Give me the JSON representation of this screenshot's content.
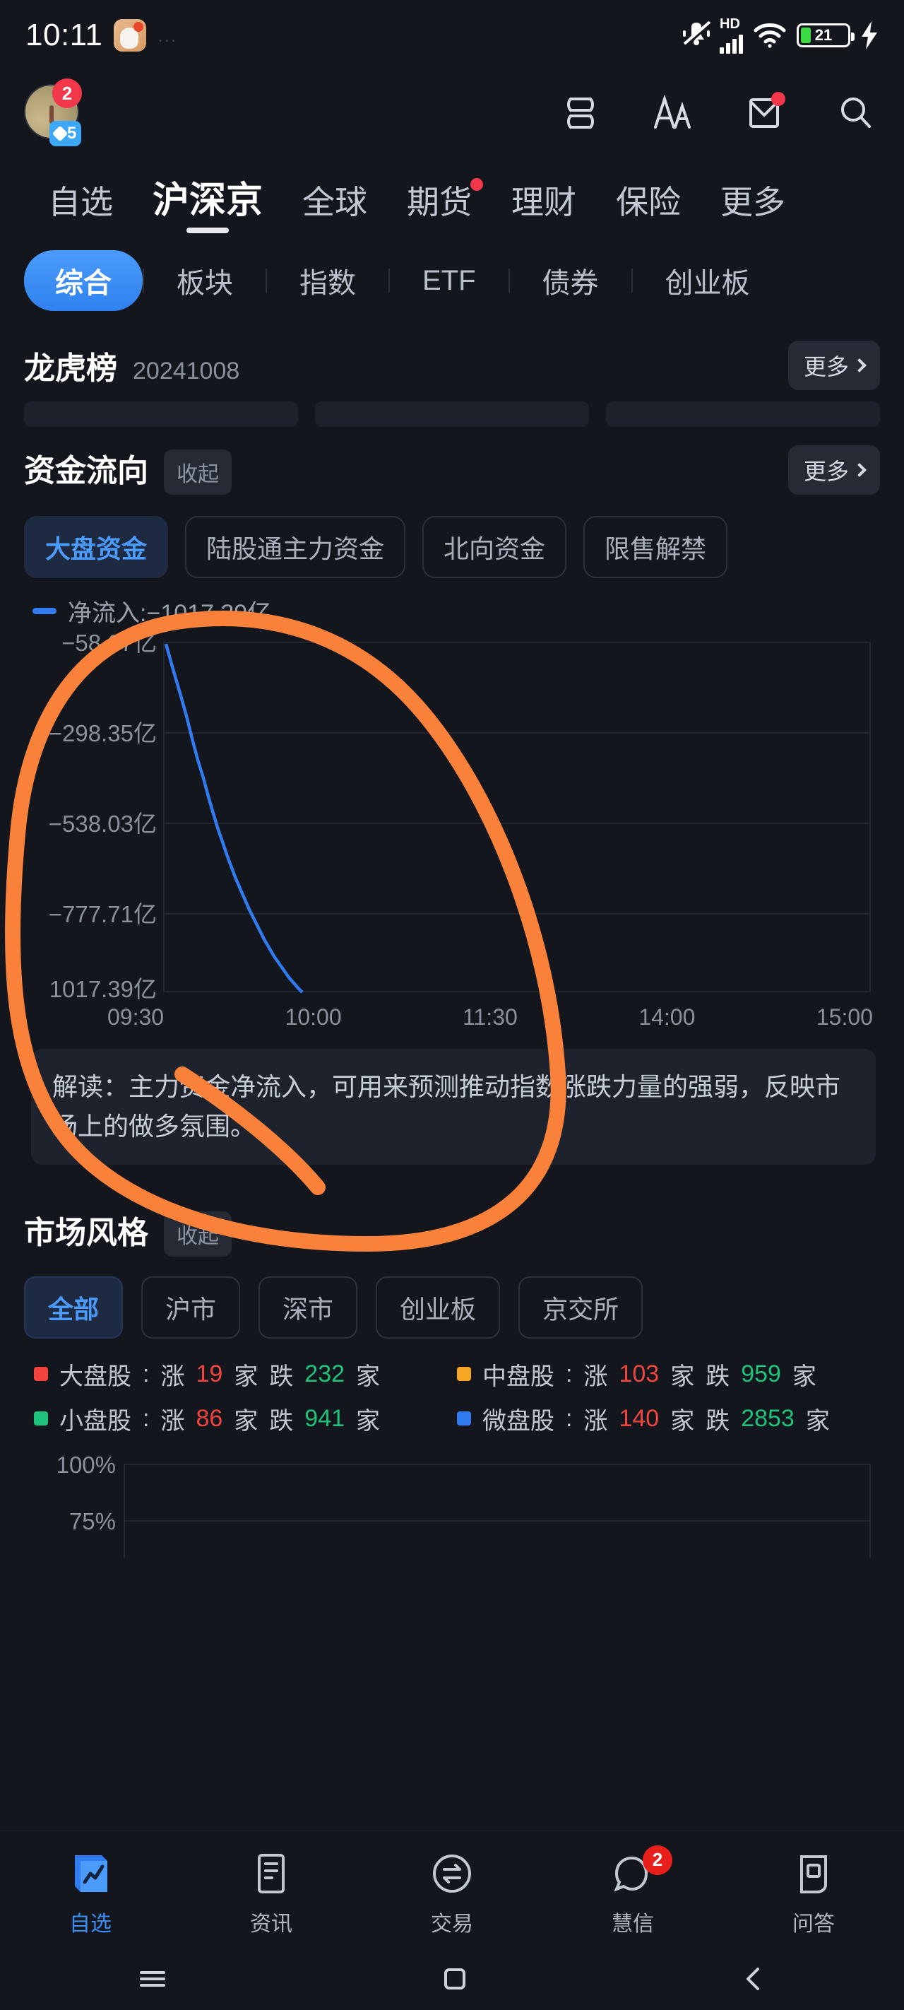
{
  "status_bar": {
    "time": "10:11",
    "ghost_text": "...",
    "hd_label": "HD",
    "battery_percent": "21",
    "icons": [
      "mute-bell-icon",
      "hd-icon",
      "signal-icon",
      "wifi-icon",
      "battery-icon",
      "charging-bolt-icon"
    ]
  },
  "header": {
    "avatar_badge_count": "2",
    "avatar_level": "5",
    "icons": [
      "layout-icon",
      "font-size-icon",
      "mail-icon",
      "search-icon"
    ]
  },
  "main_tabs": [
    {
      "label": "自选",
      "active": false,
      "dot": false
    },
    {
      "label": "沪深京",
      "active": true,
      "dot": false
    },
    {
      "label": "全球",
      "active": false,
      "dot": false
    },
    {
      "label": "期货",
      "active": false,
      "dot": true
    },
    {
      "label": "理财",
      "active": false,
      "dot": false
    },
    {
      "label": "保险",
      "active": false,
      "dot": false
    },
    {
      "label": "更多",
      "active": false,
      "dot": false
    }
  ],
  "sub_tabs": [
    {
      "label": "综合",
      "active": true
    },
    {
      "label": "板块",
      "active": false
    },
    {
      "label": "指数",
      "active": false
    },
    {
      "label": "ETF",
      "active": false
    },
    {
      "label": "债券",
      "active": false
    },
    {
      "label": "创业板",
      "active": false
    }
  ],
  "dragon_tiger": {
    "title": "龙虎榜",
    "date": "20241008",
    "more_label": "更多"
  },
  "fund_flow": {
    "title": "资金流向",
    "collapse_label": "收起",
    "more_label": "更多",
    "tabs": [
      {
        "label": "大盘资金",
        "active": true
      },
      {
        "label": "陆股通主力资金",
        "active": false
      },
      {
        "label": "北向资金",
        "active": false
      },
      {
        "label": "限售解禁",
        "active": false
      }
    ],
    "legend_label": "净流入:−1017.39亿",
    "explain": "解读：主力资金净流入，可用来预测推动指数涨跌力量的强弱，反映市场上的做多氛围。"
  },
  "market_style": {
    "title": "市场风格",
    "collapse_label": "收起",
    "chips": [
      {
        "label": "全部",
        "active": true
      },
      {
        "label": "沪市",
        "active": false
      },
      {
        "label": "深市",
        "active": false
      },
      {
        "label": "创业板",
        "active": false
      },
      {
        "label": "京交所",
        "active": false
      }
    ],
    "stats": [
      {
        "name": "大盘股",
        "color": "#f2443c",
        "up": "19",
        "down": "232"
      },
      {
        "name": "中盘股",
        "color": "#f5a623",
        "up": "103",
        "down": "959"
      },
      {
        "name": "小盘股",
        "color": "#1fc27a",
        "up": "86",
        "down": "941"
      },
      {
        "name": "微盘股",
        "color": "#2f7bef",
        "up": "140",
        "down": "2853"
      }
    ],
    "stat_prefix_up": "涨",
    "stat_prefix_down": "跌",
    "stat_unit": "家",
    "bottom_chart_labels": [
      "100%",
      "75%"
    ]
  },
  "bottom_nav": [
    {
      "label": "自选",
      "icon": "chart-book-icon",
      "active": true,
      "badge": ""
    },
    {
      "label": "资讯",
      "icon": "news-doc-icon",
      "active": false,
      "badge": ""
    },
    {
      "label": "交易",
      "icon": "trade-circle-icon",
      "active": false,
      "badge": ""
    },
    {
      "label": "慧信",
      "icon": "message-icon",
      "active": false,
      "badge": "2"
    },
    {
      "label": "问答",
      "icon": "qa-icon",
      "active": false,
      "badge": ""
    }
  ],
  "system_nav": [
    "menu-icon",
    "home-icon",
    "back-icon"
  ],
  "annotation": {
    "color": "#f9813a",
    "shape": "hand-drawn-circle"
  },
  "chart_data": {
    "type": "line",
    "title": "净流入:−1017.39亿",
    "xlabel": "",
    "ylabel": "亿",
    "x_ticks": [
      "09:30",
      "10:00",
      "11:30",
      "14:00",
      "15:00"
    ],
    "y_ticks": [
      "−58.67亿",
      "−298.35亿",
      "−538.03亿",
      "−777.71亿",
      "−1017.39亿"
    ],
    "ylim": [
      -1017.39,
      -58.67
    ],
    "series": [
      {
        "name": "净流入",
        "color": "#2f7bef",
        "x": [
          "09:30",
          "09:33",
          "09:36",
          "09:39",
          "09:42",
          "09:45",
          "09:48",
          "09:51",
          "09:54",
          "09:57",
          "10:00",
          "10:03",
          "10:06",
          "10:09",
          "10:12"
        ],
        "values": [
          -58.67,
          -150.0,
          -230.0,
          -300.0,
          -370.0,
          -430.0,
          -490.0,
          -545.0,
          -605.0,
          -665.0,
          -720.0,
          -780.0,
          -845.0,
          -930.0,
          -1017.39
        ]
      }
    ],
    "grid": true,
    "legend_position": "top-left"
  },
  "bottom_chart_data": {
    "type": "area",
    "y_ticks": [
      "100%",
      "75%"
    ],
    "ylim": [
      0,
      100
    ],
    "grid": true
  }
}
